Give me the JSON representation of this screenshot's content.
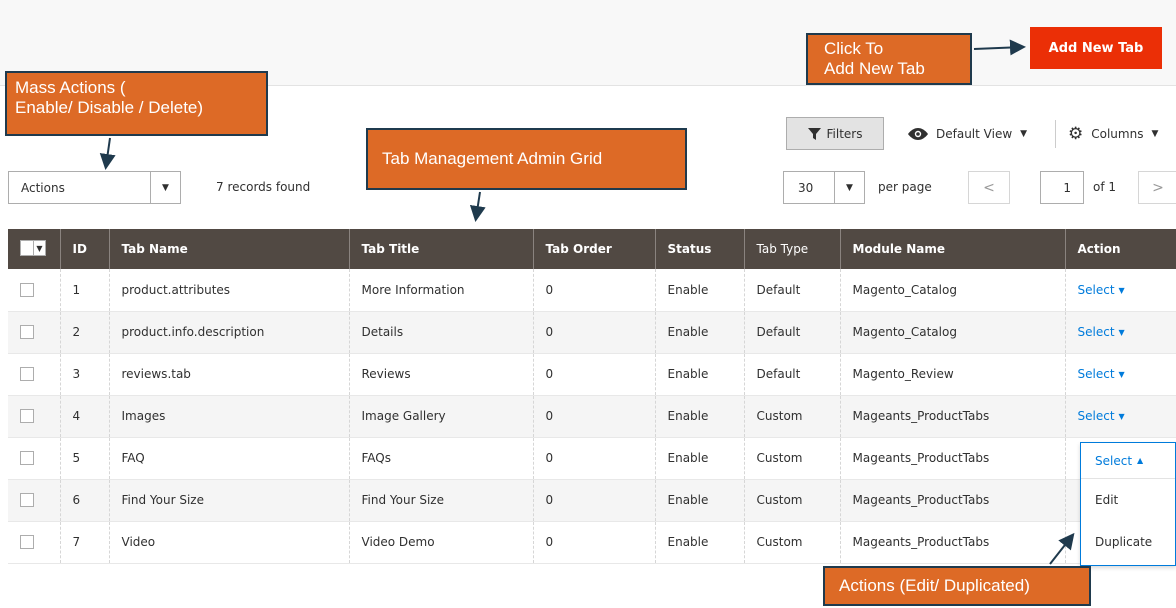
{
  "header": {
    "add_button_label": "Add New Tab"
  },
  "toolbar": {
    "filters_label": "Filters",
    "view_label": "Default View",
    "columns_label": "Columns",
    "actions_select": "Actions",
    "records_found": "7 records found",
    "per_page_value": "30",
    "per_page_label": "per page",
    "page_current": "1",
    "page_of": "of 1"
  },
  "grid": {
    "columns": [
      "ID",
      "Tab Name",
      "Tab Title",
      "Tab Order",
      "Status",
      "Tab Type",
      "Module Name",
      "Action"
    ],
    "rows": [
      {
        "id": "1",
        "name": "product.attributes",
        "title": "More Information",
        "order": "0",
        "status": "Enable",
        "type": "Default",
        "module": "Magento_Catalog",
        "action": "Select"
      },
      {
        "id": "2",
        "name": "product.info.description",
        "title": "Details",
        "order": "0",
        "status": "Enable",
        "type": "Default",
        "module": "Magento_Catalog",
        "action": "Select"
      },
      {
        "id": "3",
        "name": "reviews.tab",
        "title": "Reviews",
        "order": "0",
        "status": "Enable",
        "type": "Default",
        "module": "Magento_Review",
        "action": "Select"
      },
      {
        "id": "4",
        "name": "Images",
        "title": "Image Gallery",
        "order": "0",
        "status": "Enable",
        "type": "Custom",
        "module": "Mageants_ProductTabs",
        "action": "Select"
      },
      {
        "id": "5",
        "name": "FAQ",
        "title": "FAQs",
        "order": "0",
        "status": "Enable",
        "type": "Custom",
        "module": "Mageants_ProductTabs",
        "action": "Select"
      },
      {
        "id": "6",
        "name": "Find Your Size",
        "title": "Find Your Size",
        "order": "0",
        "status": "Enable",
        "type": "Custom",
        "module": "Mageants_ProductTabs",
        "action": "Select"
      },
      {
        "id": "7",
        "name": "Video",
        "title": "Video Demo",
        "order": "0",
        "status": "Enable",
        "type": "Custom",
        "module": "Mageants_ProductTabs",
        "action": "Select"
      }
    ]
  },
  "action_dropdown": {
    "head": "Select",
    "items": [
      "Edit",
      "Duplicate"
    ]
  },
  "callouts": {
    "mass_actions_line1": "Mass Actions (",
    "mass_actions_line2": "Enable/ Disable / Delete)",
    "grid": "Tab Management Admin Grid",
    "click_line1": "Click To",
    "click_line2": "Add New Tab",
    "actions": "Actions (Edit/ Duplicated)"
  },
  "colors": {
    "add_button": "#eb2f06",
    "grid_header": "#514943",
    "callout_fill": "#dd6a26",
    "callout_border": "#1f3a4d",
    "link": "#007bdb"
  }
}
